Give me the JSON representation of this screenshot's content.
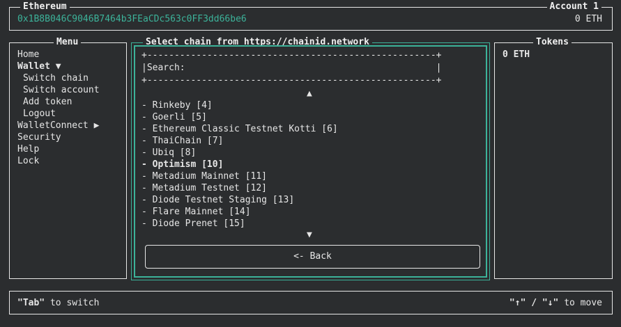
{
  "header": {
    "network_title": "Ethereum",
    "address": "0x1B8B046C9046B7464b3FEaCDc563c0FF3dd66be6",
    "account_title": "Account 1",
    "balance": "0 ETH"
  },
  "menu": {
    "title": "Menu",
    "items": [
      {
        "label": "Home"
      },
      {
        "label": "Wallet ▼"
      },
      {
        "label": "Switch chain"
      },
      {
        "label": "Switch account"
      },
      {
        "label": "Add token"
      },
      {
        "label": "Logout"
      },
      {
        "label": "WalletConnect ▶"
      },
      {
        "label": "Security"
      },
      {
        "label": "Help"
      },
      {
        "label": "Lock"
      }
    ]
  },
  "chain_panel": {
    "title": "Select chain from https://chainid.network",
    "border_top": "+-----------------------------------------------------+",
    "search_line": "|Search:                                              |",
    "border_bottom": "+-----------------------------------------------------+",
    "scroll_up": "▲",
    "scroll_down": "▼",
    "chains": [
      "- Rinkeby [4]",
      "- Goerli [5]",
      "- Ethereum Classic Testnet Kotti [6]",
      "- ThaiChain [7]",
      "- Ubiq [8]",
      "- Optimism [10]",
      "- Metadium Mainnet [11]",
      "- Metadium Testnet [12]",
      "- Diode Testnet Staging [13]",
      "- Flare Mainnet [14]",
      "- Diode Prenet [15]"
    ],
    "selected_index": 5,
    "back_label": "<- Back"
  },
  "tokens": {
    "title": "Tokens",
    "items": [
      "0 ETH"
    ]
  },
  "footer": {
    "left_key": "\"Tab\"",
    "left_text": " to switch",
    "right_keys": "\"↑\" / \"↓\"",
    "right_text": " to move"
  },
  "colors": {
    "accent": "#3cb39a",
    "background": "#2b2d2f",
    "border": "#e8e8e8"
  }
}
